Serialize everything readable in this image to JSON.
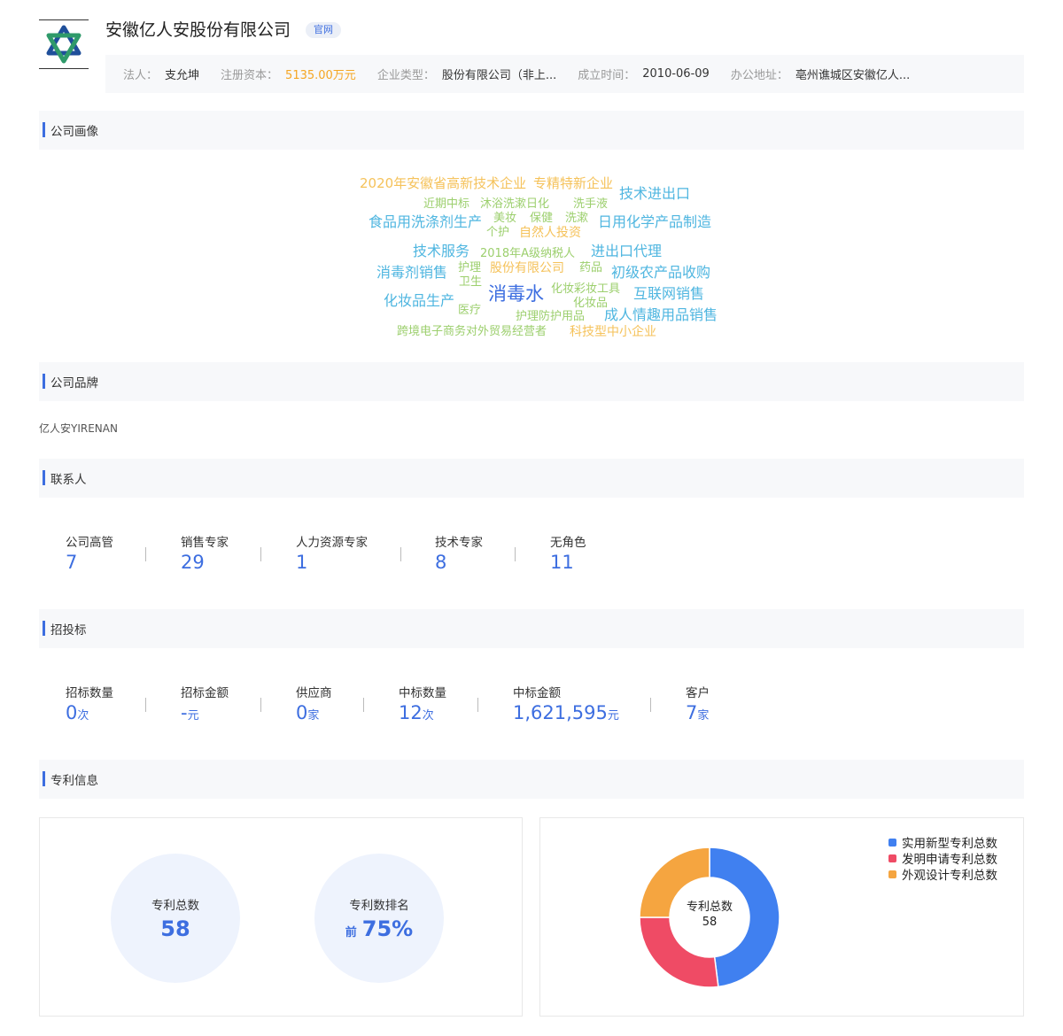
{
  "header": {
    "company_name": "安徽亿人安股份有限公司",
    "official_badge": "官网",
    "info": [
      {
        "label": "法人：",
        "value": "支允坤"
      },
      {
        "label": "注册资本：",
        "value": "5135.00万元"
      },
      {
        "label": "企业类型：",
        "value": "股份有限公司（非上..."
      },
      {
        "label": "成立时间：",
        "value": "2010-06-09"
      },
      {
        "label": "办公地址：",
        "value": "亳州谯城区安徽亿人..."
      }
    ]
  },
  "sections": {
    "portrait": "公司画像",
    "brand": "公司品牌",
    "contacts": "联系人",
    "bidding": "招投标",
    "patents": "专利信息"
  },
  "word_cloud": [
    {
      "text": "2020年安徽省高新技术企业",
      "color": "#f5c25a"
    },
    {
      "text": "专精特新企业",
      "color": "#f5c25a"
    },
    {
      "text": "技术进出口",
      "color": "#4fb6e0"
    },
    {
      "text": "近期中标",
      "color": "#9ccf6d"
    },
    {
      "text": "沐浴洗漱日化",
      "color": "#9ccf6d"
    },
    {
      "text": "洗手液",
      "color": "#9ccf6d"
    },
    {
      "text": "食品用洗涤剂生产",
      "color": "#4fb6e0"
    },
    {
      "text": "美妆",
      "color": "#9ccf6d"
    },
    {
      "text": "保健",
      "color": "#9ccf6d"
    },
    {
      "text": "洗漱",
      "color": "#9ccf6d"
    },
    {
      "text": "日用化学产品制造",
      "color": "#4fb6e0"
    },
    {
      "text": "个护",
      "color": "#9ccf6d"
    },
    {
      "text": "自然人投资",
      "color": "#f5c25a"
    },
    {
      "text": "技术服务",
      "color": "#4fb6e0"
    },
    {
      "text": "2018年A级纳税人",
      "color": "#9ccf6d"
    },
    {
      "text": "进出口代理",
      "color": "#4fb6e0"
    },
    {
      "text": "消毒剂销售",
      "color": "#4fb6e0"
    },
    {
      "text": "护理",
      "color": "#9ccf6d"
    },
    {
      "text": "股份有限公司",
      "color": "#f5c25a"
    },
    {
      "text": "药品",
      "color": "#9ccf6d"
    },
    {
      "text": "初级农产品收购",
      "color": "#4fb6e0"
    },
    {
      "text": "卫生",
      "color": "#9ccf6d"
    },
    {
      "text": "消毒水",
      "color": "#3d6ee0"
    },
    {
      "text": "化妆彩妆工具",
      "color": "#9ccf6d"
    },
    {
      "text": "互联网销售",
      "color": "#4fb6e0"
    },
    {
      "text": "化妆品生产",
      "color": "#4fb6e0"
    },
    {
      "text": "化妆品",
      "color": "#9ccf6d"
    },
    {
      "text": "医疗",
      "color": "#9ccf6d"
    },
    {
      "text": "护理防护用品",
      "color": "#9ccf6d"
    },
    {
      "text": "成人情趣用品销售",
      "color": "#4fb6e0"
    },
    {
      "text": "跨境电子商务对外贸易经营者",
      "color": "#9ccf6d"
    },
    {
      "text": "科技型中小企业",
      "color": "#f5c25a"
    }
  ],
  "brand": {
    "name": "亿人安YIRENAN"
  },
  "contacts": [
    {
      "label": "公司高管",
      "value": "7"
    },
    {
      "label": "销售专家",
      "value": "29"
    },
    {
      "label": "人力资源专家",
      "value": "1"
    },
    {
      "label": "技术专家",
      "value": "8"
    },
    {
      "label": "无角色",
      "value": "11"
    }
  ],
  "bidding": [
    {
      "label": "招标数量",
      "value": "0",
      "unit": "次"
    },
    {
      "label": "招标金额",
      "value": "-",
      "unit": "元"
    },
    {
      "label": "供应商",
      "value": "0",
      "unit": "家"
    },
    {
      "label": "中标数量",
      "value": "12",
      "unit": "次"
    },
    {
      "label": "中标金额",
      "value": "1,621,595",
      "unit": "元"
    },
    {
      "label": "客户",
      "value": "7",
      "unit": "家"
    }
  ],
  "patents": {
    "total_label": "专利总数",
    "total_value": "58",
    "rank_label": "专利数排名",
    "rank_prefix": "前",
    "rank_value": "75%",
    "donut": {
      "center_label": "专利总数",
      "center_value": "58",
      "series": [
        {
          "name": "实用新型专利总数",
          "value": 0.48,
          "color": "#4080f0"
        },
        {
          "name": "发明申请专利总数",
          "value": 0.27,
          "color": "#ef4b65"
        },
        {
          "name": "外观设计专利总数",
          "value": 0.25,
          "color": "#f5a540"
        }
      ]
    }
  }
}
